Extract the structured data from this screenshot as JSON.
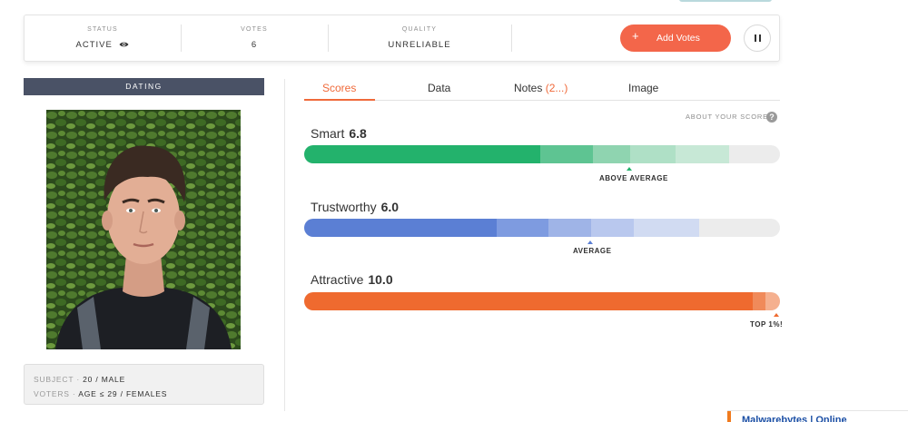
{
  "stats": {
    "status_label": "STATUS",
    "status_value": "ACTIVE",
    "votes_label": "VOTES",
    "votes_value": "6",
    "quality_label": "QUALITY",
    "quality_value": "UNRELIABLE",
    "add_votes_plus": "+",
    "add_votes_label": "Add Votes",
    "pause_icon": "pause-icon",
    "eye_icon": "eye-icon"
  },
  "category": "DATING",
  "subject_info": {
    "subject_key": "SUBJECT",
    "subject_value": "20 / MALE",
    "voters_key": "VOTERS",
    "voters_value": "AGE ≤ 29 / FEMALES",
    "separator": " · "
  },
  "tabs": {
    "scores": "Scores",
    "data": "Data",
    "notes": "Notes",
    "notes_count": "(2...)",
    "image": "Image"
  },
  "about_scores": "ABOUT YOUR SCORES",
  "help_icon": "?",
  "scores": [
    {
      "name": "Smart",
      "value": "6.8",
      "marker_label": "ABOVE AVERAGE",
      "color": "#23b26c"
    },
    {
      "name": "Trustworthy",
      "value": "6.0",
      "marker_label": "AVERAGE",
      "color": "#5b7fd4"
    },
    {
      "name": "Attractive",
      "value": "10.0",
      "marker_label": "TOP 1%!",
      "color": "#ef6a2f"
    }
  ],
  "colors": {
    "accent": "#f06a3a",
    "button": "#f3664a",
    "header": "#4a5266"
  },
  "bottom_popup": "Malwarebytes | Online"
}
